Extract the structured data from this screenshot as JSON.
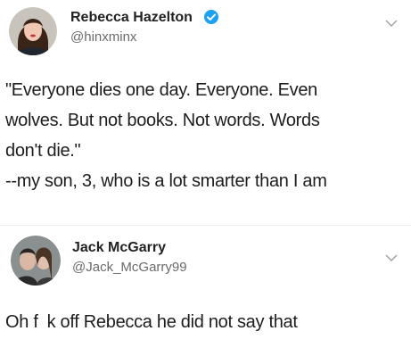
{
  "tweet1": {
    "author_name": "Rebecca Hazelton",
    "author_handle": "@hinxminx",
    "verified": true,
    "lines": [
      "\"Everyone dies one day. Everyone. Even",
      "wolves. But not books. Not words. Words",
      "don't die.\"",
      "--my son, 3, who is a lot smarter than I am"
    ]
  },
  "tweet2": {
    "author_name": "Jack McGarry",
    "author_handle": "@Jack_McGarry99",
    "reply_start": "Oh f",
    "reply_end": "k off Rebecca he did not say that"
  },
  "icons": {
    "verified": "verified-badge-icon",
    "menu": "chevron-down-icon"
  },
  "colors": {
    "verified_blue": "#1da1f2",
    "handle_gray": "#6b6b6b"
  }
}
